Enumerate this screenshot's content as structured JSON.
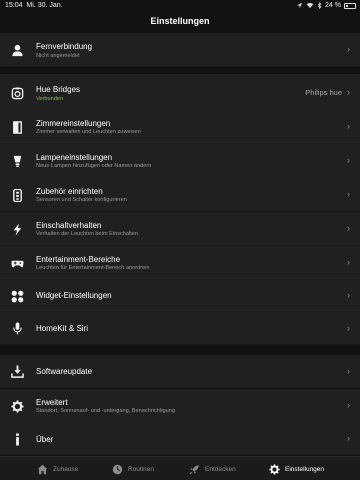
{
  "status": {
    "time": "15:04",
    "date": "Mi. 30. Jan.",
    "battery": "24 %"
  },
  "header": {
    "title": "Einstellungen"
  },
  "rows": [
    {
      "title": "Fernverbindung",
      "subtitle": "Nicht angemeldet",
      "icon": "person-icon"
    },
    {
      "title": "Hue Bridges",
      "subtitle": "Verbunden",
      "value": "Philips hue",
      "icon": "bridge-icon"
    },
    {
      "title": "Zimmereinstellungen",
      "subtitle": "Zimmer verwalten und Leuchten zuweisen",
      "icon": "door-icon"
    },
    {
      "title": "Lampeneinstellungen",
      "subtitle": "Neue Lampen hinzufügen oder Namen ändern",
      "icon": "lamp-icon"
    },
    {
      "title": "Zubehör einrichten",
      "subtitle": "Sensoren und Schalter konfigurieren",
      "icon": "remote-icon"
    },
    {
      "title": "Einschaltverhalten",
      "subtitle": "Verhalten der Leuchten beim Einschalten",
      "icon": "bolt-icon"
    },
    {
      "title": "Entertainment-Bereiche",
      "subtitle": "Leuchten für Entertainment-Bereich anordnen",
      "icon": "gamepad-icon"
    },
    {
      "title": "Widget-Einstellungen",
      "icon": "widgets-icon"
    },
    {
      "title": "HomeKit & Siri",
      "icon": "microphone-icon"
    },
    {
      "title": "Softwareupdate",
      "icon": "download-icon"
    },
    {
      "title": "Erweitert",
      "subtitle": "Standort, Sonnenauf- und -untergang, Benachrichtigung",
      "icon": "gear-icon"
    },
    {
      "title": "Über",
      "icon": "info-icon"
    }
  ],
  "tabs": [
    {
      "label": "Zuhause",
      "icon": "home-icon"
    },
    {
      "label": "Routinen",
      "icon": "clock-icon"
    },
    {
      "label": "Entdecken",
      "icon": "rocket-icon"
    },
    {
      "label": "Einstellungen",
      "icon": "gear-icon",
      "active": true
    }
  ],
  "colors": {
    "background": "#121212",
    "row": "#202020",
    "connected": "#7ac142"
  }
}
